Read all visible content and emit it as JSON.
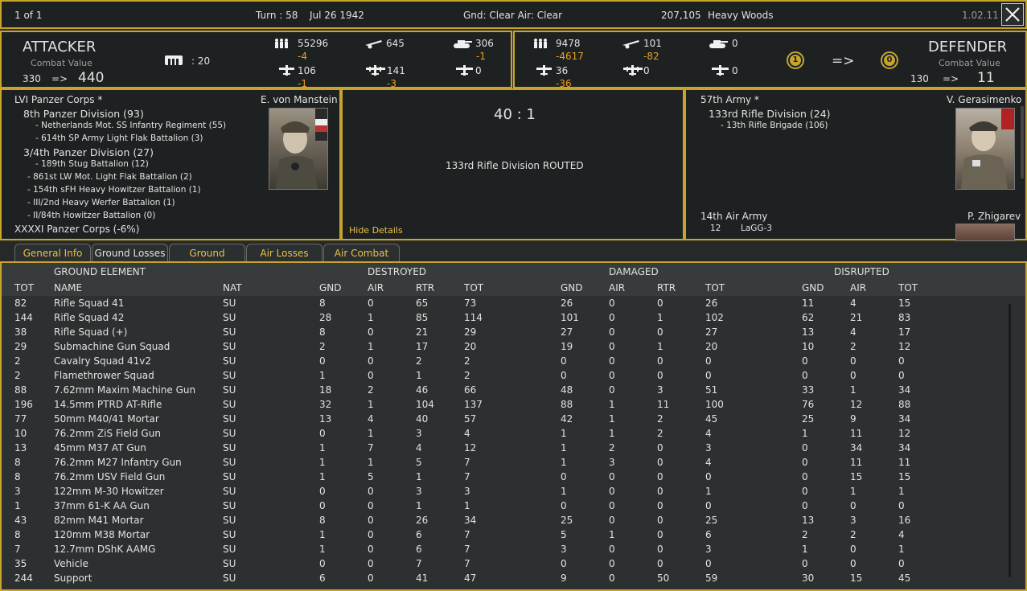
{
  "topbar": {
    "page": "1 of 1",
    "turn": "Turn : 58",
    "date": "Jul 26 1942",
    "weather": "Gnd: Clear  Air: Clear",
    "hex_value": "207,105",
    "terrain": "Heavy Woods",
    "version": "1.02.11"
  },
  "attacker": {
    "title": "ATTACKER",
    "cv_label": "Combat Value",
    "cv_from": "330",
    "arrow": "=>",
    "cv_to": "440",
    "fort_value": ": 20",
    "men": "55296",
    "men_loss": "-4",
    "guns": "645",
    "tanks": "306",
    "tanks_loss": "-1",
    "air1": "106",
    "air1_loss": "-1",
    "air2": "141",
    "air2_loss": "-3",
    "air3": "0"
  },
  "defender": {
    "title": "DEFENDER",
    "cv_label": "Combat Value",
    "cv_from": "130",
    "arrow": "=>",
    "cv_to": "11",
    "men": "9478",
    "men_loss": "-4617",
    "guns": "101",
    "guns_loss": "-82",
    "tanks": "0",
    "air1": "36",
    "air1_loss": "-36",
    "air2": "0",
    "air3": "0",
    "fort_from": "1",
    "fort_arrow": "=>",
    "fort_to": "0"
  },
  "attacker_units": {
    "corps": "LVI Panzer Corps *",
    "commander": "E. von Manstein",
    "lines": [
      "8th Panzer Division (93)",
      "- Netherlands Mot. SS Infantry Regiment (55)",
      "- 614th SP Army Light Flak Battalion (3)",
      "3/4th Panzer Division (27)",
      "- 189th Stug Battalion (12)",
      "- 861st LW Mot. Light Flak Battalion (2)",
      "- 154th sFH Heavy Howitzer Battalion (1)",
      "- III/2nd Heavy Werfer Battalion (1)",
      "- II/84th Howitzer Battalion (0)"
    ],
    "support_corps": "XXXXI Panzer Corps (-6%)"
  },
  "result": {
    "odds": "40 : 1",
    "message": "133rd Rifle Division ROUTED",
    "hide_details": "Hide Details"
  },
  "defender_units": {
    "army": "57th Army *",
    "commander": "V. Gerasimenko",
    "division": "133rd Rifle Division (24)",
    "brigade": "- 13th Rifle Brigade (106)",
    "air_army": "14th Air Army",
    "air_commander": "P. Zhigarev",
    "air_count": "12",
    "air_type": "LaGG-3"
  },
  "tabs": [
    "General Info",
    "Ground Losses",
    "Ground Combat",
    "Air Losses",
    "Air Combat"
  ],
  "table": {
    "group_headers": {
      "element": "GROUND ELEMENT",
      "destroyed": "DESTROYED",
      "damaged": "DAMAGED",
      "disrupted": "DISRUPTED"
    },
    "columns": [
      "TOT",
      "NAME",
      "NAT",
      "GND",
      "AIR",
      "RTR",
      "TOT",
      "GND",
      "AIR",
      "RTR",
      "TOT",
      "GND",
      "AIR",
      "TOT"
    ],
    "rows": [
      [
        "82",
        "Rifle Squad 41",
        "SU",
        "8",
        "0",
        "65",
        "73",
        "26",
        "0",
        "0",
        "26",
        "11",
        "4",
        "15"
      ],
      [
        "144",
        "Rifle Squad 42",
        "SU",
        "28",
        "1",
        "85",
        "114",
        "101",
        "0",
        "1",
        "102",
        "62",
        "21",
        "83"
      ],
      [
        "38",
        "Rifle Squad (+)",
        "SU",
        "8",
        "0",
        "21",
        "29",
        "27",
        "0",
        "0",
        "27",
        "13",
        "4",
        "17"
      ],
      [
        "29",
        "Submachine Gun Squad",
        "SU",
        "2",
        "1",
        "17",
        "20",
        "19",
        "0",
        "1",
        "20",
        "10",
        "2",
        "12"
      ],
      [
        "2",
        "Cavalry Squad 41v2",
        "SU",
        "0",
        "0",
        "2",
        "2",
        "0",
        "0",
        "0",
        "0",
        "0",
        "0",
        "0"
      ],
      [
        "2",
        "Flamethrower Squad",
        "SU",
        "1",
        "0",
        "1",
        "2",
        "0",
        "0",
        "0",
        "0",
        "0",
        "0",
        "0"
      ],
      [
        "88",
        "7.62mm Maxim Machine Gun",
        "SU",
        "18",
        "2",
        "46",
        "66",
        "48",
        "0",
        "3",
        "51",
        "33",
        "1",
        "34"
      ],
      [
        "196",
        "14.5mm PTRD AT-Rifle",
        "SU",
        "32",
        "1",
        "104",
        "137",
        "88",
        "1",
        "11",
        "100",
        "76",
        "12",
        "88"
      ],
      [
        "77",
        "50mm M40/41 Mortar",
        "SU",
        "13",
        "4",
        "40",
        "57",
        "42",
        "1",
        "2",
        "45",
        "25",
        "9",
        "34"
      ],
      [
        "10",
        "76.2mm ZiS Field Gun",
        "SU",
        "0",
        "1",
        "3",
        "4",
        "1",
        "1",
        "2",
        "4",
        "1",
        "11",
        "12"
      ],
      [
        "13",
        "45mm M37 AT Gun",
        "SU",
        "1",
        "7",
        "4",
        "12",
        "1",
        "2",
        "0",
        "3",
        "0",
        "34",
        "34"
      ],
      [
        "8",
        "76.2mm M27 Infantry Gun",
        "SU",
        "1",
        "1",
        "5",
        "7",
        "1",
        "3",
        "0",
        "4",
        "0",
        "11",
        "11"
      ],
      [
        "8",
        "76.2mm USV Field Gun",
        "SU",
        "1",
        "5",
        "1",
        "7",
        "0",
        "0",
        "0",
        "0",
        "0",
        "15",
        "15"
      ],
      [
        "3",
        "122mm M-30 Howitzer",
        "SU",
        "0",
        "0",
        "3",
        "3",
        "1",
        "0",
        "0",
        "1",
        "0",
        "1",
        "1"
      ],
      [
        "1",
        "37mm 61-K AA Gun",
        "SU",
        "0",
        "0",
        "1",
        "1",
        "0",
        "0",
        "0",
        "0",
        "0",
        "0",
        "0"
      ],
      [
        "43",
        "82mm M41 Mortar",
        "SU",
        "8",
        "0",
        "26",
        "34",
        "25",
        "0",
        "0",
        "25",
        "13",
        "3",
        "16"
      ],
      [
        "8",
        "120mm M38 Mortar",
        "SU",
        "1",
        "0",
        "6",
        "7",
        "5",
        "1",
        "0",
        "6",
        "2",
        "2",
        "4"
      ],
      [
        "7",
        "12.7mm DShK AAMG",
        "SU",
        "1",
        "0",
        "6",
        "7",
        "3",
        "0",
        "0",
        "3",
        "1",
        "0",
        "1"
      ],
      [
        "35",
        "Vehicle",
        "SU",
        "0",
        "0",
        "7",
        "7",
        "0",
        "0",
        "0",
        "0",
        "0",
        "0",
        "0"
      ],
      [
        "244",
        "Support",
        "SU",
        "6",
        "0",
        "41",
        "47",
        "9",
        "0",
        "50",
        "59",
        "30",
        "15",
        "45"
      ]
    ]
  },
  "colors": {
    "gold": "#c9a42a",
    "loss": "#e8a020",
    "tab_text": "#e8c04a"
  },
  "icons": [
    "men-icon",
    "gun-icon",
    "tank-icon",
    "fighter-icon",
    "bomber-icon",
    "fort-icon",
    "close-icon"
  ]
}
